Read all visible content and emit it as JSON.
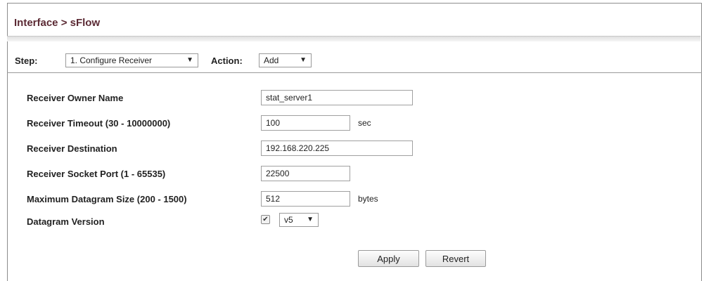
{
  "page": {
    "title": "Interface > sFlow"
  },
  "toolbar": {
    "step_label": "Step:",
    "step_value": "1. Configure Receiver",
    "action_label": "Action:",
    "action_value": "Add"
  },
  "form": {
    "owner_name_label": "Receiver Owner Name",
    "owner_name_value": "stat_server1",
    "timeout_label": "Receiver Timeout (30 - 10000000)",
    "timeout_value": "100",
    "timeout_unit": "sec",
    "destination_label": "Receiver Destination",
    "destination_value": "192.168.220.225",
    "socket_port_label": "Receiver Socket Port (1 - 65535)",
    "socket_port_value": "22500",
    "datagram_size_label": "Maximum Datagram Size (200 - 1500)",
    "datagram_size_value": "512",
    "datagram_size_unit": "bytes",
    "datagram_version_label": "Datagram Version",
    "datagram_version_checked": true,
    "datagram_version_value": "v5"
  },
  "buttons": {
    "apply_label": "Apply",
    "revert_label": "Revert"
  },
  "icons": {
    "dropdown_arrow": "chevron-down-icon",
    "checkmark": "check-icon"
  },
  "colors": {
    "title": "#5b2a34",
    "border": "#8c8c8c"
  }
}
